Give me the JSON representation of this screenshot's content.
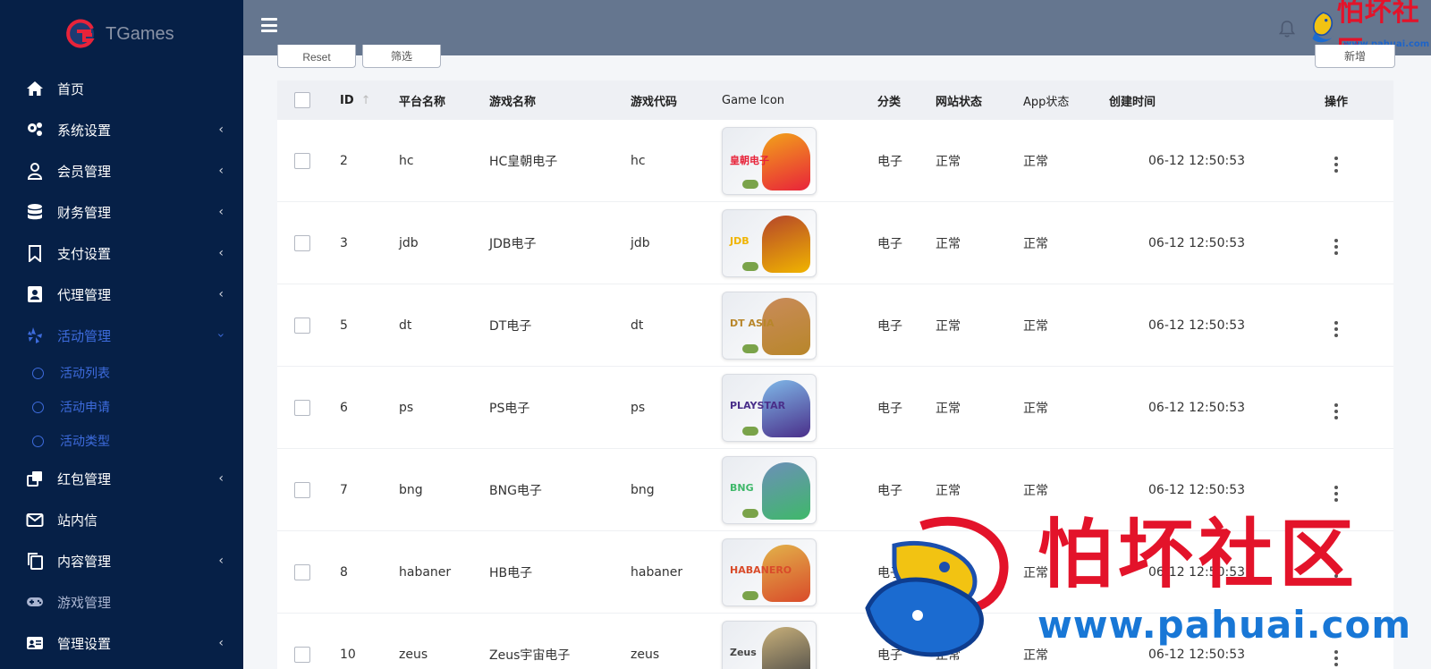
{
  "brand": {
    "name": "TGames"
  },
  "sidebar": {
    "items": [
      {
        "label": "首页",
        "icon": "home-icon",
        "has_chevron": false
      },
      {
        "label": "系统设置",
        "icon": "gears-icon",
        "has_chevron": true
      },
      {
        "label": "会员管理",
        "icon": "user-icon",
        "has_chevron": true
      },
      {
        "label": "财务管理",
        "icon": "database-icon",
        "has_chevron": true
      },
      {
        "label": "支付设置",
        "icon": "bookmark-icon",
        "has_chevron": true
      },
      {
        "label": "代理管理",
        "icon": "contact-card-icon",
        "has_chevron": true
      },
      {
        "label": "活动管理",
        "icon": "yelp-icon",
        "has_chevron": true,
        "expanded": true
      },
      {
        "label": "红包管理",
        "icon": "clone-icon",
        "has_chevron": true
      },
      {
        "label": "站内信",
        "icon": "envelope-icon",
        "has_chevron": false
      },
      {
        "label": "内容管理",
        "icon": "copy-icon",
        "has_chevron": true
      },
      {
        "label": "游戏管理",
        "icon": "gamepad-icon",
        "has_chevron": false
      },
      {
        "label": "管理设置",
        "icon": "id-card-icon",
        "has_chevron": true
      }
    ],
    "sub_items": [
      {
        "label": "活动列表"
      },
      {
        "label": "活动申请"
      },
      {
        "label": "活动类型"
      }
    ],
    "chevron": "‹"
  },
  "toolbar": {
    "left_buttons": [
      "Reset",
      "筛选"
    ],
    "right_button": "新增"
  },
  "table": {
    "headers": {
      "id": "ID",
      "platform": "平台名称",
      "name": "游戏名称",
      "code": "游戏代码",
      "icon": "Game Icon",
      "category": "分类",
      "web_status": "网站状态",
      "app_status": "App状态",
      "created": "创建时间",
      "actions": "操作"
    },
    "rows": [
      {
        "id": "2",
        "platform": "hc",
        "name": "HC皇朝电子",
        "code": "hc",
        "icon_logo": "皇朝电子",
        "category": "电子",
        "web_status": "正常",
        "app_status": "正常",
        "created": "06-12 12:50:53"
      },
      {
        "id": "3",
        "platform": "jdb",
        "name": "JDB电子",
        "code": "jdb",
        "icon_logo": "JDB",
        "category": "电子",
        "web_status": "正常",
        "app_status": "正常",
        "created": "06-12 12:50:53"
      },
      {
        "id": "5",
        "platform": "dt",
        "name": "DT电子",
        "code": "dt",
        "icon_logo": "DT ASIA",
        "category": "电子",
        "web_status": "正常",
        "app_status": "正常",
        "created": "06-12 12:50:53"
      },
      {
        "id": "6",
        "platform": "ps",
        "name": "PS电子",
        "code": "ps",
        "icon_logo": "PLAYSTAR",
        "category": "电子",
        "web_status": "正常",
        "app_status": "正常",
        "created": "06-12 12:50:53"
      },
      {
        "id": "7",
        "platform": "bng",
        "name": "BNG电子",
        "code": "bng",
        "icon_logo": "BNG",
        "category": "电子",
        "web_status": "正常",
        "app_status": "正常",
        "created": "06-12 12:50:53"
      },
      {
        "id": "8",
        "platform": "habaner",
        "name": "HB电子",
        "code": "habaner",
        "icon_logo": "HABANERO",
        "category": "电子",
        "web_status": "正常",
        "app_status": "正常",
        "created": "06-12 12:50:53"
      },
      {
        "id": "10",
        "platform": "zeus",
        "name": "Zeus宇宙电子",
        "code": "zeus",
        "icon_logo": "Zeus",
        "category": "电子",
        "web_status": "正常",
        "app_status": "正常",
        "created": "06-12 12:50:53"
      }
    ]
  },
  "watermark": {
    "text": "怕坏社区",
    "url": "www.pahuai.com",
    "small_url": "www.pahuai.com"
  },
  "colors": {
    "sidebar_bg": "#062047",
    "topbar_bg": "#65768f",
    "accent": "#3d6bdc",
    "watermark_red": "#e3132a",
    "watermark_blue": "#1877d6"
  }
}
